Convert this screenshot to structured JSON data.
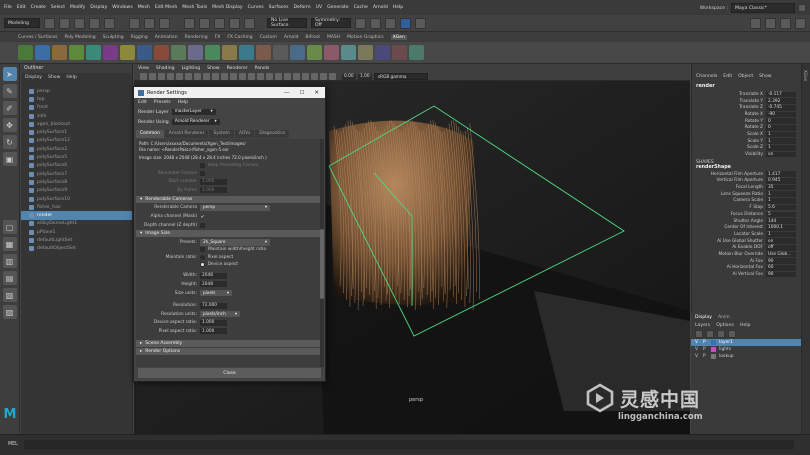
{
  "menubar": {
    "items": [
      "File",
      "Edit",
      "Create",
      "Select",
      "Modify",
      "Display",
      "Windows",
      "Mesh",
      "Edit Mesh",
      "Mesh Tools",
      "Mesh Display",
      "Curves",
      "Surfaces",
      "Deform",
      "UV",
      "Generate",
      "Cache",
      "Arnold",
      "Help"
    ],
    "workspace_label": "Workspace :",
    "workspace_value": "Maya Classic*"
  },
  "statusline": {
    "mode": "Modeling",
    "live_surface": "No Live Surface",
    "symmetry": "Symmetry: Off"
  },
  "shelf": {
    "tabs": [
      "Curves / Surfaces",
      "Poly Modeling",
      "Sculpting",
      "Rigging",
      "Animation",
      "Rendering",
      "FX",
      "FX Caching",
      "Custom",
      "Arnold",
      "Bifrost",
      "MASH",
      "Motion Graphics",
      "XGen"
    ],
    "active_tab": "XGen"
  },
  "outliner": {
    "title": "Outliner",
    "menu": [
      "Display",
      "Show",
      "Help"
    ],
    "items": [
      {
        "label": "persp",
        "selected": false
      },
      {
        "label": "top",
        "selected": false
      },
      {
        "label": "front",
        "selected": false
      },
      {
        "label": "side",
        "selected": false
      },
      {
        "label": "xgen_blockout",
        "selected": false
      },
      {
        "label": "polySurface1",
        "selected": false
      },
      {
        "label": "polySurface12",
        "selected": false
      },
      {
        "label": "polySurface2",
        "selected": false
      },
      {
        "label": "polySurface5",
        "selected": false
      },
      {
        "label": "polySurface6",
        "selected": false
      },
      {
        "label": "polySurface7",
        "selected": false
      },
      {
        "label": "polySurface8",
        "selected": false
      },
      {
        "label": "polySurface9",
        "selected": false
      },
      {
        "label": "polySurface10",
        "selected": false
      },
      {
        "label": "fisher_hair",
        "selected": false
      },
      {
        "label": "render",
        "selected": true
      },
      {
        "label": "aiSkyDomeLight1",
        "selected": false
      },
      {
        "label": "pPlane1",
        "selected": false
      },
      {
        "label": "defaultLightSet",
        "selected": false
      },
      {
        "label": "defaultObjectSet",
        "selected": false
      }
    ]
  },
  "viewport": {
    "menu": [
      "View",
      "Shading",
      "Lighting",
      "Show",
      "Renderer",
      "Panels"
    ],
    "colorspace": "sRGB gamma",
    "camera_label": "persp"
  },
  "render_settings": {
    "title": "Render Settings",
    "window_controls": [
      "—",
      "☐",
      "✕"
    ],
    "menu": [
      "Edit",
      "Presets",
      "Help"
    ],
    "render_layer_label": "Render Layer",
    "render_layer_value": "masterLayer",
    "render_using_label": "Render Using",
    "render_using_value": "Arnold Renderer",
    "tabs": [
      "Common",
      "Arnold Renderer",
      "System",
      "AOVs",
      "Diagnostics"
    ],
    "active_tab": "Common",
    "path_lines": [
      "Path: C:/Users/xxxxx/Documents/Xgen_Test/images/",
      "File name:   <RenderPass>/fisher_xgen-5.exr",
      "",
      "Image size: 2048 x 2048 (28.4 x 28.4 inches 72.0 pixels/inch )"
    ],
    "frame_section": {
      "keep_frame_label": "Keep Preceding Frames",
      "renumber_label": "Renumber Frames",
      "start_number_label": "Start number",
      "start_number_value": "1.000",
      "by_frame_label": "By frame",
      "by_frame_value": "1.000"
    },
    "renderable_cameras": {
      "title": "Renderable Cameras",
      "camera_label": "Renderable Camera",
      "camera_value": "persp",
      "alpha_label": "Alpha channel (Mask)",
      "alpha_value": "✔",
      "depth_label": "Depth channel (Z depth)"
    },
    "image_size": {
      "title": "Image Size",
      "presets_label": "Presets:",
      "presets_value": "2k_Square",
      "maintain_ratio_label": "Maintain width/height ratio",
      "maintain_ratio_field": "Maintain ratio:",
      "pixel_aspect_label": "Pixel aspect",
      "device_aspect_label": "Device aspect",
      "width_label": "Width:",
      "width_value": "2048",
      "height_label": "Height:",
      "height_value": "2048",
      "size_units_label": "Size units:",
      "size_units_value": "pixels",
      "resolution_label": "Resolution:",
      "resolution_value": "72.000",
      "resolution_units_label": "Resolution units:",
      "resolution_units_value": "pixels/inch",
      "device_ratio_label": "Device aspect ratio:",
      "device_ratio_value": "1.000",
      "pixel_ratio_label": "Pixel aspect ratio:",
      "pixel_ratio_value": "1.000"
    },
    "collapsed_sections": [
      "Scene Assembly",
      "Render Options"
    ],
    "close_label": "Close"
  },
  "channelbox": {
    "menu": [
      "Channels",
      "Edit",
      "Object",
      "Show"
    ],
    "object_name": "render",
    "transform_attrs": [
      {
        "k": "Translate X",
        "v": "-0.117"
      },
      {
        "k": "Translate Y",
        "v": "2.392"
      },
      {
        "k": "Translate Z",
        "v": "-0.745"
      },
      {
        "k": "Rotate X",
        "v": "-90"
      },
      {
        "k": "Rotate Y",
        "v": "0"
      },
      {
        "k": "Rotate Z",
        "v": "0"
      },
      {
        "k": "Scale X",
        "v": "1"
      },
      {
        "k": "Scale Y",
        "v": "1"
      },
      {
        "k": "Scale Z",
        "v": "1"
      },
      {
        "k": "Visibility",
        "v": "on"
      }
    ],
    "shapes_label": "SHAPES",
    "shape_name": "renderShape",
    "shape_attrs": [
      {
        "k": "Horizontal Film Aperture",
        "v": "1.417"
      },
      {
        "k": "Vertical Film Aperture",
        "v": "0.945"
      },
      {
        "k": "Focal Length",
        "v": "35"
      },
      {
        "k": "Lens Squeeze Ratio",
        "v": "1"
      },
      {
        "k": "Camera Scale",
        "v": "1"
      },
      {
        "k": "F Stop",
        "v": "5.6"
      },
      {
        "k": "Focus Distance",
        "v": "5"
      },
      {
        "k": "Shutter Angle",
        "v": "144"
      },
      {
        "k": "Center Of Interest",
        "v": "1000.1"
      },
      {
        "k": "Locator Scale",
        "v": "1"
      },
      {
        "k": "Ai Use Global Shutter",
        "v": "on"
      },
      {
        "k": "Ai Enable DOF",
        "v": "off"
      },
      {
        "k": "Motion Blur Override",
        "v": "Use Glob..."
      },
      {
        "k": "Ai Fov",
        "v": "90"
      },
      {
        "k": "Ai Horizontal Fov",
        "v": "60"
      },
      {
        "k": "Ai Vertical Fov",
        "v": "90"
      }
    ],
    "side_tabs": [
      "Channel Box / Layer Editor",
      "Modeling Toolkit",
      "Attribute Editor",
      "Tool Settings",
      "XGen"
    ]
  },
  "layer_editor": {
    "tabs": [
      "Display",
      "Anim"
    ],
    "menu": [
      "Layers",
      "Options",
      "Help"
    ],
    "layers": [
      {
        "label": "layer1",
        "color": "#3c6fb0"
      },
      {
        "label": "lights",
        "color": "#c64fc6"
      },
      {
        "label": "lookup",
        "color": "#777777"
      }
    ]
  },
  "timeline": {
    "mel_label": "MEL"
  },
  "watermark": {
    "cn_text": "灵感中国",
    "url_text": "lingganchina.com"
  },
  "colors": {
    "selection": "#5284b0",
    "maya_logo": "#24a6c8",
    "camera_frustum": "#4fd882",
    "hair": "#a77a4e"
  }
}
